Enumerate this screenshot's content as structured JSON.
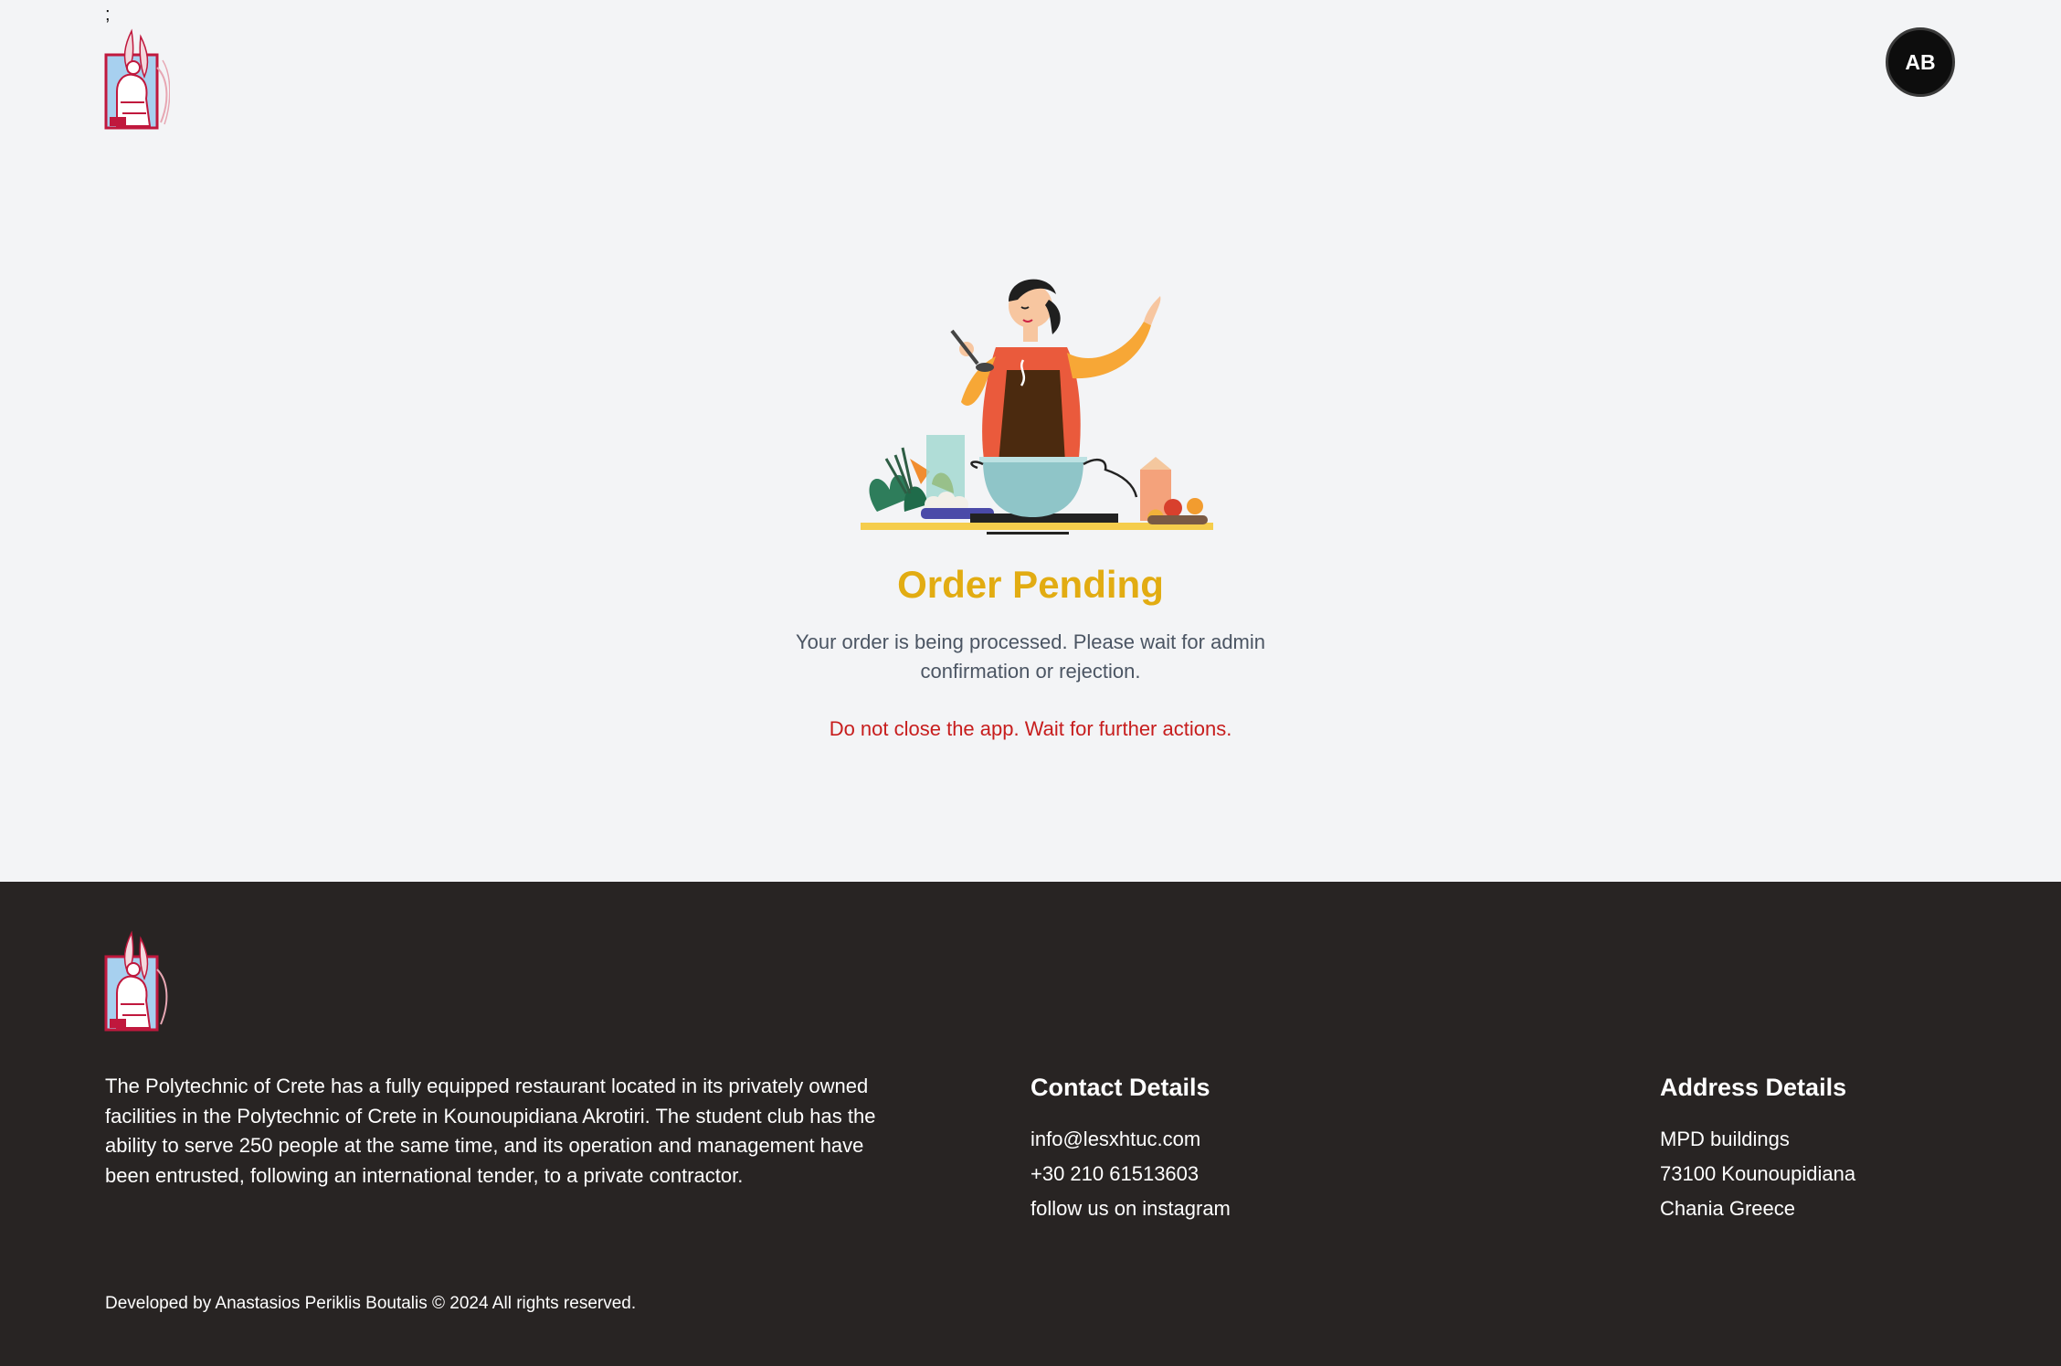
{
  "header": {
    "stray_text": ";",
    "logo_icon": "polytechnic-crete-logo",
    "avatar_initials": "AB"
  },
  "main": {
    "illustration_icon": "chef-cooking-illustration",
    "title": "Order Pending",
    "message": "Your order is being processed. Please wait for admin confirmation or rejection.",
    "warning": "Do not close the app. Wait for further actions."
  },
  "footer": {
    "about": "The Polytechnic of Crete has a fully equipped restaurant located in its privately owned facilities in the Polytechnic of Crete in Kounoupidiana Akrotiri. The student club has the ability to serve 250 people at the same time, and its operation and management have been entrusted, following an international tender, to a private contractor.",
    "contact": {
      "title": "Contact Details",
      "email": "info@lesxhtuc.com",
      "phone": "+30 210 61513603",
      "instagram": "follow us on instagram"
    },
    "address": {
      "title": "Address Details",
      "line1": "MPD buildings",
      "line2": "73100 Kounoupidiana",
      "line3": "Chania Greece"
    },
    "copyright": "Developed by Anastasios Periklis Boutalis © 2024 All rights reserved."
  },
  "colors": {
    "background": "#f3f4f6",
    "title": "#e2ac12",
    "warning": "#c71d1d",
    "footer": "#282423",
    "avatar": "#0d0d0d"
  }
}
